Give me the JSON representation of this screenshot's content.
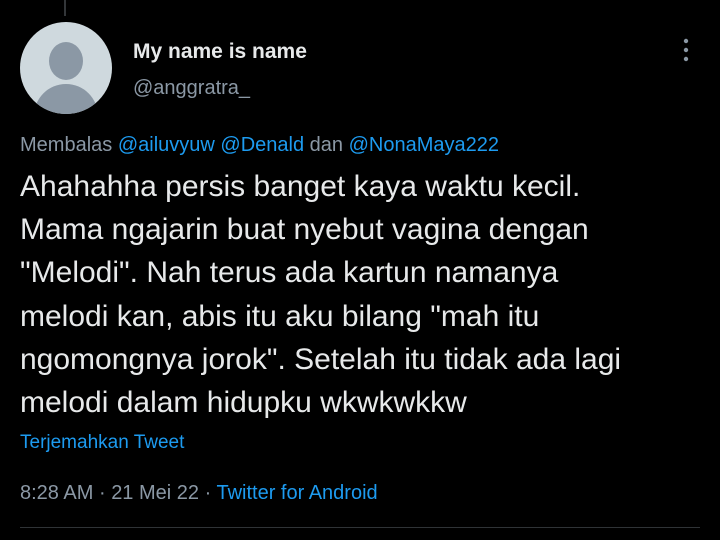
{
  "author": {
    "display_name": "My name is name",
    "handle": "@anggratra_",
    "avatar_icon": "default-profile-avatar-icon"
  },
  "reply": {
    "prefix": "Membalas",
    "mentions": [
      "@ailuvyuw",
      "@Denald",
      "@NonaMaya222"
    ],
    "conjunction": "dan"
  },
  "tweet": {
    "text": "Ahahahha persis banget kaya waktu kecil.\nMama ngajarin buat nyebut vagina dengan\n\"Melodi\". Nah terus ada kartun namanya\nmelodi kan, abis itu aku bilang \"mah itu\nngomongnya jorok\". Setelah itu tidak ada lagi\nmelodi dalam hidupku wkwkwkkw",
    "translate_label": "Terjemahkan Tweet"
  },
  "meta": {
    "time": "8:28 AM",
    "separator": "·",
    "date": "21 Mei 22",
    "source": "Twitter for Android"
  },
  "icons": {
    "more": "more-vertical-icon"
  },
  "colors": {
    "background": "#000000",
    "text_primary": "#e7e9ea",
    "text_secondary": "#8b98a5",
    "accent": "#1d9bf0",
    "avatar_bg": "#cfd9de",
    "avatar_fg": "#8b98a5"
  }
}
